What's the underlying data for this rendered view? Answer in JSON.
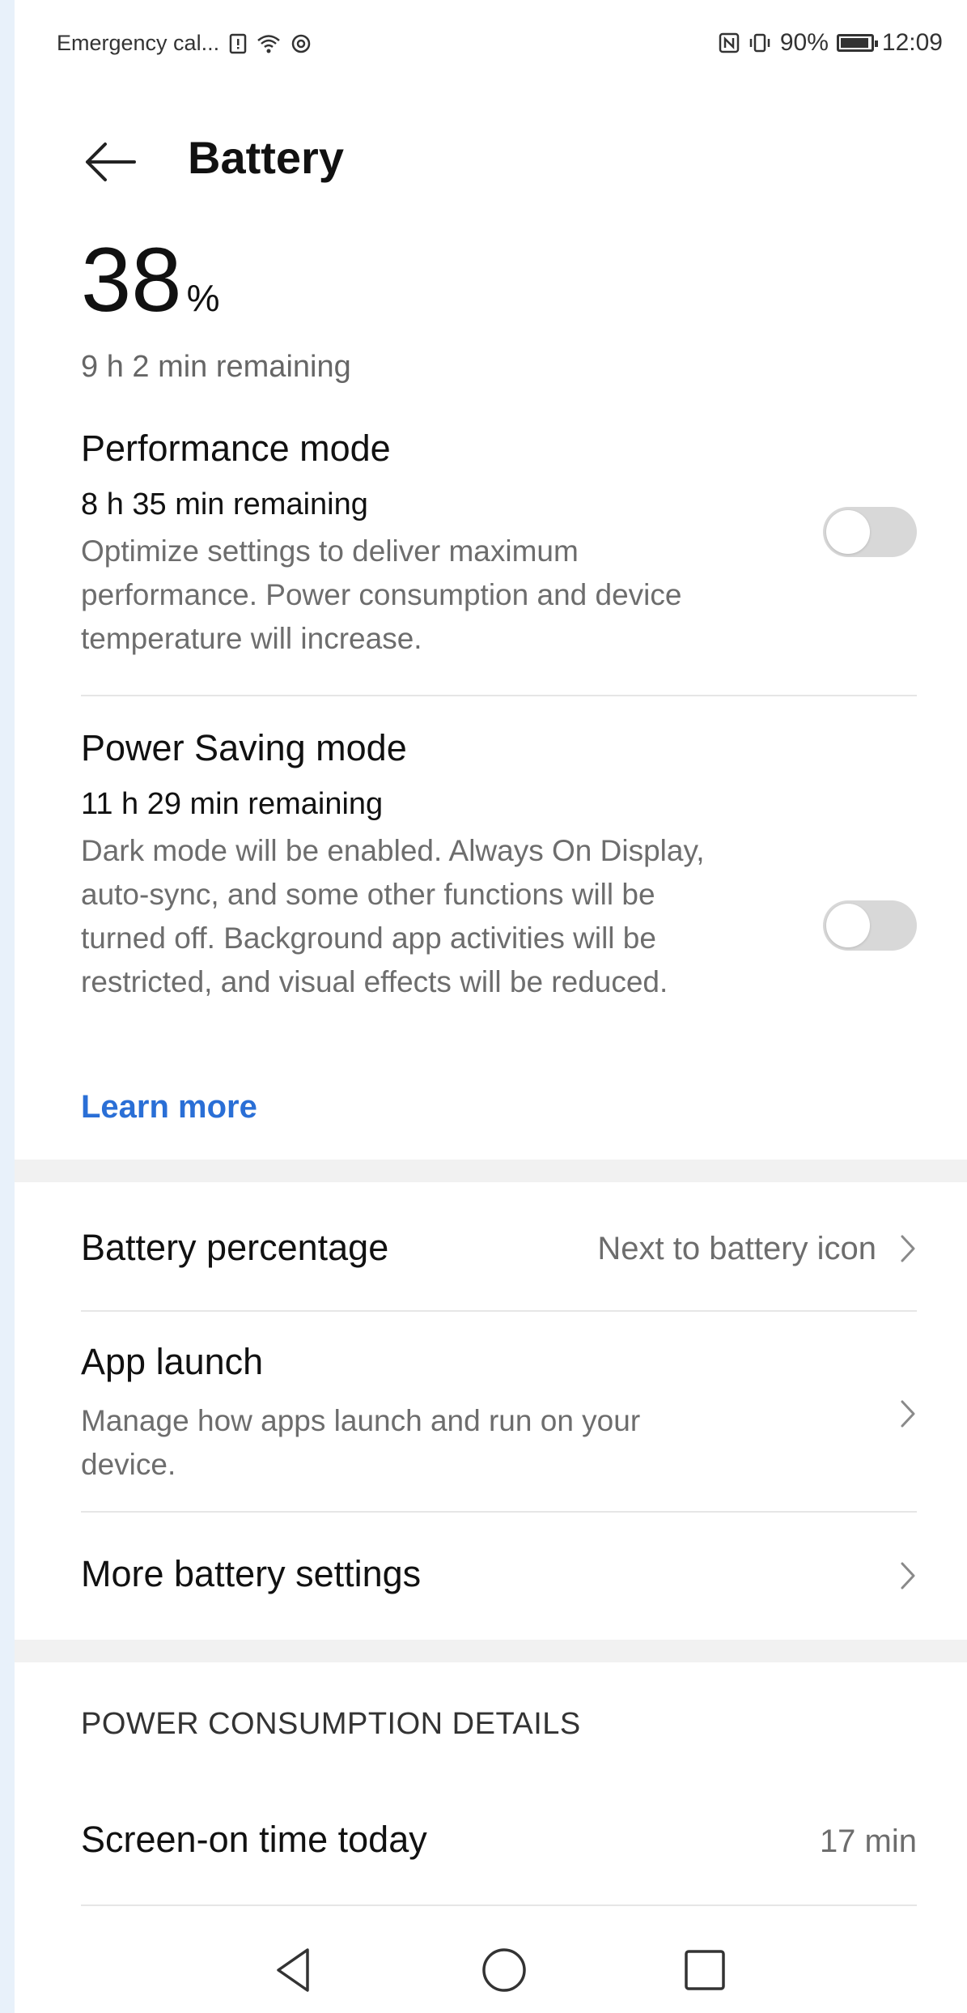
{
  "status_bar": {
    "carrier_text": "Emergency cal...",
    "battery_text": "90%",
    "time": "12:09"
  },
  "header": {
    "title": "Battery"
  },
  "battery": {
    "percent": "38",
    "unit": "%",
    "remaining": "9 h 2 min remaining"
  },
  "performance_mode": {
    "title": "Performance mode",
    "remaining": "8 h 35 min remaining",
    "description": "Optimize settings to deliver maximum performance. Power consumption and device temperature will increase.",
    "enabled": false
  },
  "power_saving_mode": {
    "title": "Power Saving mode",
    "remaining": "11 h 29 min remaining",
    "description": "Dark mode will be enabled. Always On Display, auto-sync, and some other functions will be turned off. Background app activities will be restricted, and visual effects will be reduced.",
    "enabled": false,
    "learn_more": "Learn more"
  },
  "settings": {
    "battery_percentage_label": "Battery percentage",
    "battery_percentage_value": "Next to battery icon",
    "app_launch_label": "App launch",
    "app_launch_desc": "Manage how apps launch and run on your device.",
    "more_settings_label": "More battery settings"
  },
  "consumption": {
    "header": "POWER CONSUMPTION DETAILS",
    "screen_on_label": "Screen-on time today",
    "screen_on_value": "17 min"
  },
  "colors": {
    "accent": "#2a6fd6",
    "toggle_off": "#d8d8d8",
    "background": "#ffffff"
  },
  "icons": [
    "back-arrow-icon",
    "chevron-right-icon",
    "nav-back-icon",
    "nav-home-icon",
    "nav-recents-icon"
  ]
}
